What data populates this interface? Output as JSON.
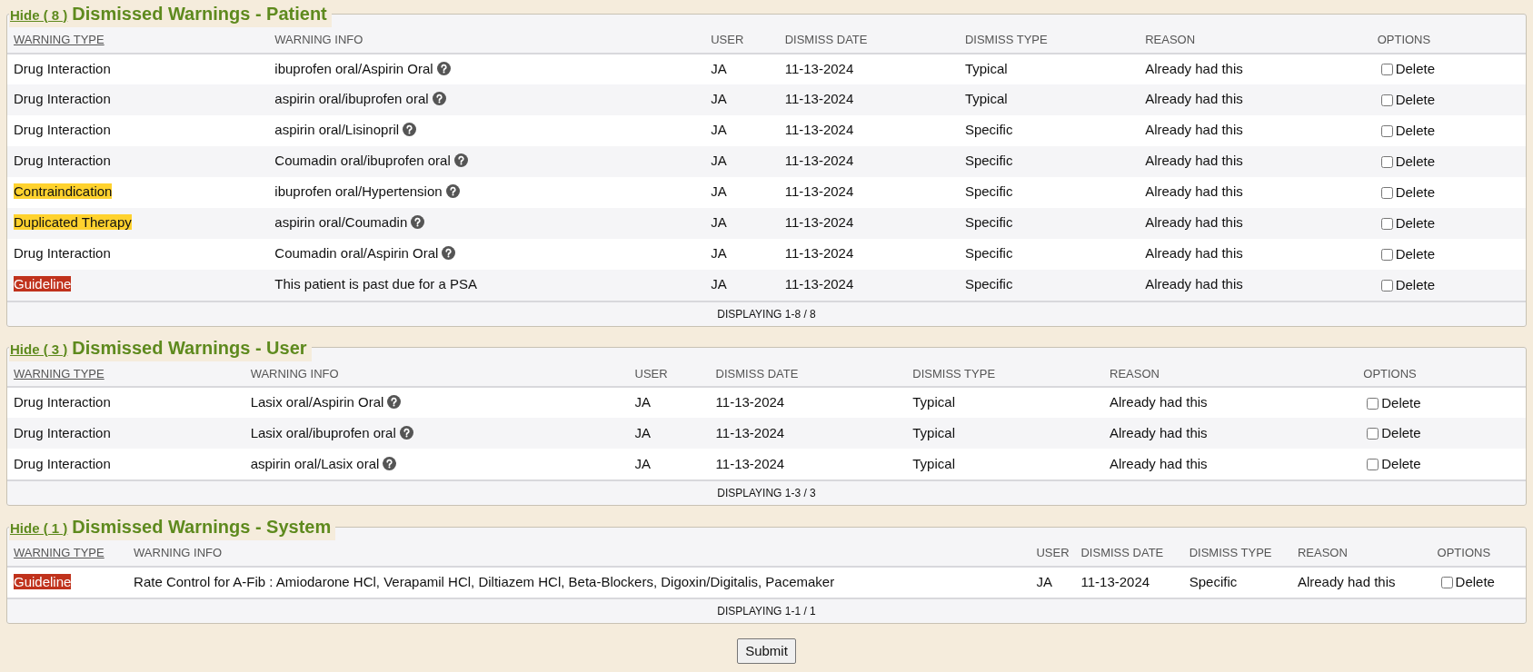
{
  "sections": [
    {
      "hide_link": "Hide ( 8 )",
      "title": "Dismissed Warnings - Patient",
      "columns": [
        "WARNING TYPE",
        "WARNING INFO",
        "USER",
        "DISMISS DATE",
        "DISMISS TYPE",
        "REASON",
        "OPTIONS"
      ],
      "rows": [
        {
          "warning_type": "Drug Interaction",
          "kind": "plain",
          "info": "ibuprofen oral/Aspirin Oral",
          "help": true,
          "user": "JA",
          "date": "11-13-2024",
          "dismiss_type": "Typical",
          "reason": "Already had this",
          "option": "Delete",
          "checked": false
        },
        {
          "warning_type": "Drug Interaction",
          "kind": "plain",
          "info": "aspirin oral/ibuprofen oral",
          "help": true,
          "user": "JA",
          "date": "11-13-2024",
          "dismiss_type": "Typical",
          "reason": "Already had this",
          "option": "Delete",
          "checked": false
        },
        {
          "warning_type": "Drug Interaction",
          "kind": "plain",
          "info": "aspirin oral/Lisinopril",
          "help": true,
          "user": "JA",
          "date": "11-13-2024",
          "dismiss_type": "Specific",
          "reason": "Already had this",
          "option": "Delete",
          "checked": false
        },
        {
          "warning_type": "Drug Interaction",
          "kind": "plain",
          "info": "Coumadin oral/ibuprofen oral",
          "help": true,
          "user": "JA",
          "date": "11-13-2024",
          "dismiss_type": "Specific",
          "reason": "Already had this",
          "option": "Delete",
          "checked": false
        },
        {
          "warning_type": "Contraindication",
          "kind": "caution",
          "info": "ibuprofen oral/Hypertension",
          "help": true,
          "user": "JA",
          "date": "11-13-2024",
          "dismiss_type": "Specific",
          "reason": "Already had this",
          "option": "Delete",
          "checked": false
        },
        {
          "warning_type": "Duplicated Therapy",
          "kind": "caution",
          "info": "aspirin oral/Coumadin",
          "help": true,
          "user": "JA",
          "date": "11-13-2024",
          "dismiss_type": "Specific",
          "reason": "Already had this",
          "option": "Delete",
          "checked": false
        },
        {
          "warning_type": "Drug Interaction",
          "kind": "plain",
          "info": "Coumadin oral/Aspirin Oral",
          "help": true,
          "user": "JA",
          "date": "11-13-2024",
          "dismiss_type": "Specific",
          "reason": "Already had this",
          "option": "Delete",
          "checked": false
        },
        {
          "warning_type": "Guideline",
          "kind": "alert",
          "info": "This patient is past due for a PSA",
          "help": false,
          "user": "JA",
          "date": "11-13-2024",
          "dismiss_type": "Specific",
          "reason": "Already had this",
          "option": "Delete",
          "checked": false
        }
      ],
      "footer": "DISPLAYING 1-8 / 8"
    },
    {
      "hide_link": "Hide ( 3 )",
      "title": "Dismissed Warnings - User",
      "columns": [
        "WARNING TYPE",
        "WARNING INFO",
        "USER",
        "DISMISS DATE",
        "DISMISS TYPE",
        "REASON",
        "OPTIONS"
      ],
      "rows": [
        {
          "warning_type": "Drug Interaction",
          "kind": "plain",
          "info": "Lasix oral/Aspirin Oral",
          "help": true,
          "user": "JA",
          "date": "11-13-2024",
          "dismiss_type": "Typical",
          "reason": "Already had this",
          "option": "Delete",
          "checked": false
        },
        {
          "warning_type": "Drug Interaction",
          "kind": "plain",
          "info": "Lasix oral/ibuprofen oral",
          "help": true,
          "user": "JA",
          "date": "11-13-2024",
          "dismiss_type": "Typical",
          "reason": "Already had this",
          "option": "Delete",
          "checked": false
        },
        {
          "warning_type": "Drug Interaction",
          "kind": "plain",
          "info": "aspirin oral/Lasix oral",
          "help": true,
          "user": "JA",
          "date": "11-13-2024",
          "dismiss_type": "Typical",
          "reason": "Already had this",
          "option": "Delete",
          "checked": false
        }
      ],
      "footer": "DISPLAYING 1-3 / 3"
    },
    {
      "hide_link": "Hide ( 1 )",
      "title": "Dismissed Warnings - System",
      "columns": [
        "WARNING TYPE",
        "WARNING INFO",
        "USER",
        "DISMISS DATE",
        "DISMISS TYPE",
        "REASON",
        "OPTIONS"
      ],
      "rows": [
        {
          "warning_type": "Guideline",
          "kind": "alert",
          "info": "Rate Control for A-Fib : Amiodarone HCl, Verapamil HCl, Diltiazem HCl, Beta-Blockers, Digoxin/Digitalis, Pacemaker",
          "help": false,
          "user": "JA",
          "date": "11-13-2024",
          "dismiss_type": "Specific",
          "reason": "Already had this",
          "option": "Delete",
          "checked": false
        }
      ],
      "footer": "DISPLAYING 1-1 / 1"
    }
  ],
  "submit": "Submit"
}
